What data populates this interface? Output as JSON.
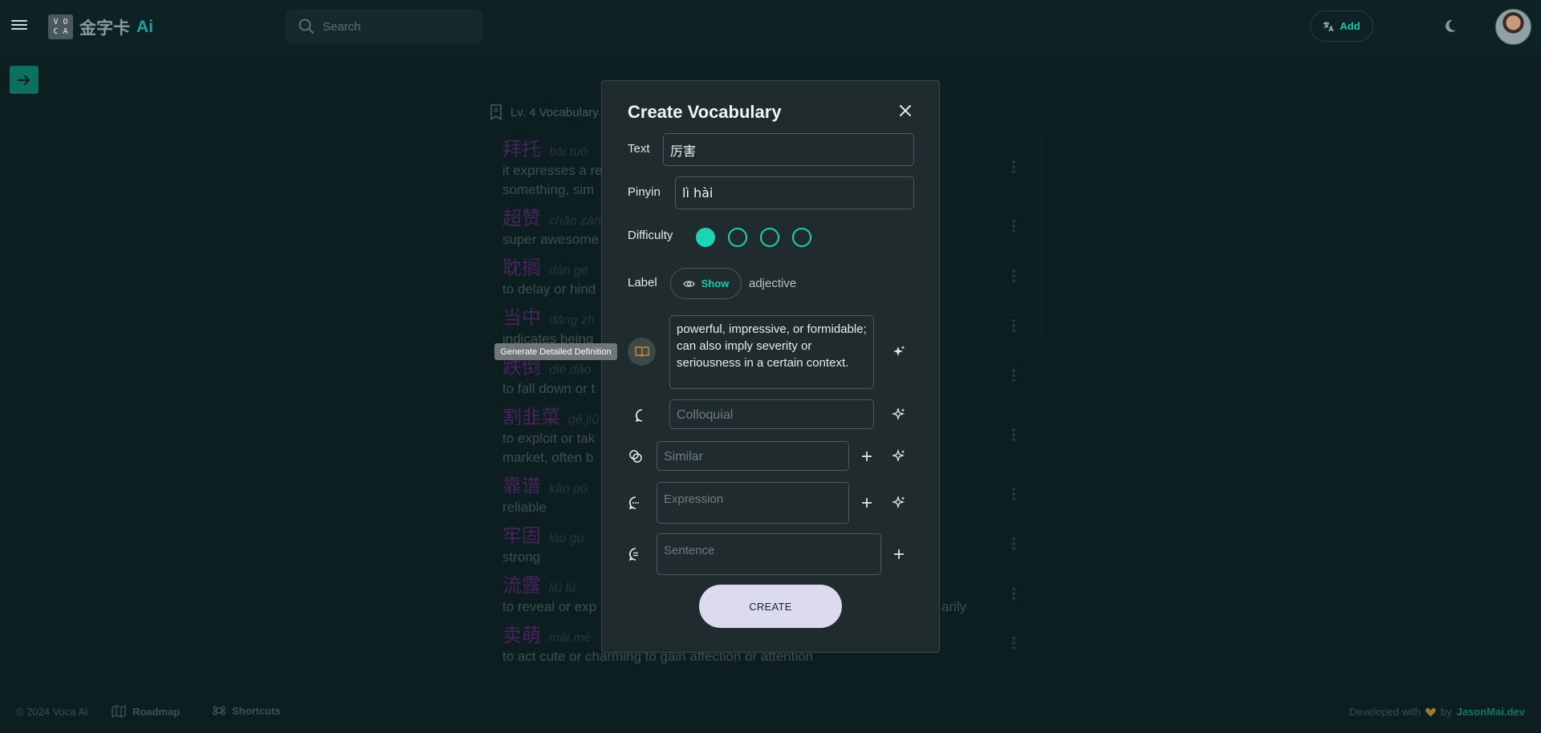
{
  "app": {
    "logo_mark": [
      "V",
      "O",
      "C",
      "A"
    ],
    "logo_cn": "金字卡",
    "logo_ai": "Ai",
    "accent": "#1ed2b3"
  },
  "header": {
    "search_placeholder": "Search",
    "add_label": "Add"
  },
  "list": {
    "header": "Lv. 4 Vocabulary",
    "items": [
      {
        "hanzi": "拜托",
        "pinyin": "bài tuō",
        "def": [
          "it expresses a re",
          "something, sim"
        ]
      },
      {
        "hanzi": "超赞",
        "pinyin": "chāo zàn",
        "def": [
          "super awesome"
        ]
      },
      {
        "hanzi": "耽搁",
        "pinyin": "dān gē",
        "def": [
          "to delay or hind"
        ]
      },
      {
        "hanzi": "当中",
        "pinyin": "dāng zh",
        "def": [
          "indicates being"
        ]
      },
      {
        "hanzi": "跌倒",
        "pinyin": "diē dǎo",
        "def": [
          "to fall down or t"
        ]
      },
      {
        "hanzi": "割韭菜",
        "pinyin": "gē jiǔ",
        "def": [
          "to exploit or tak",
          "market, often b"
        ]
      },
      {
        "hanzi": "靠谱",
        "pinyin": "kào pǔ",
        "def": [
          "reliable"
        ]
      },
      {
        "hanzi": "牢固",
        "pinyin": "láo gù",
        "def": [
          "strong"
        ]
      },
      {
        "hanzi": "流露",
        "pinyin": "liú lù",
        "def": [
          "to reveal or exp"
        ],
        "def_tail": "arily"
      },
      {
        "hanzi": "卖萌",
        "pinyin": "mài mè",
        "def": [
          "to act cute or charming to gain affection or attention"
        ]
      }
    ]
  },
  "modal": {
    "title": "Create Vocabulary",
    "text_label": "Text",
    "text_value": "厉害",
    "pinyin_label": "Pinyin",
    "pinyin_value": "lì hài",
    "difficulty_label": "Difficulty",
    "difficulty_level": 1,
    "difficulty_max": 4,
    "label_label": "Label",
    "show_label": "Show",
    "label_value": "adjective",
    "definition": "powerful, impressive, or formidable; can also imply severity or seriousness in a certain context.",
    "colloquial_placeholder": "Colloquial",
    "similar_placeholder": "Similar",
    "expression_placeholder": "Expression",
    "sentence_placeholder": "Sentence",
    "create_label": "CREATE"
  },
  "tooltip": "Generate Detailed Definition",
  "footer": {
    "copyright": "© 2024 Voca Ai",
    "roadmap": "Roadmap",
    "shortcuts": "Shortcuts",
    "developed_with": "Developed with",
    "by": "by",
    "author": "JasonMai.dev"
  }
}
